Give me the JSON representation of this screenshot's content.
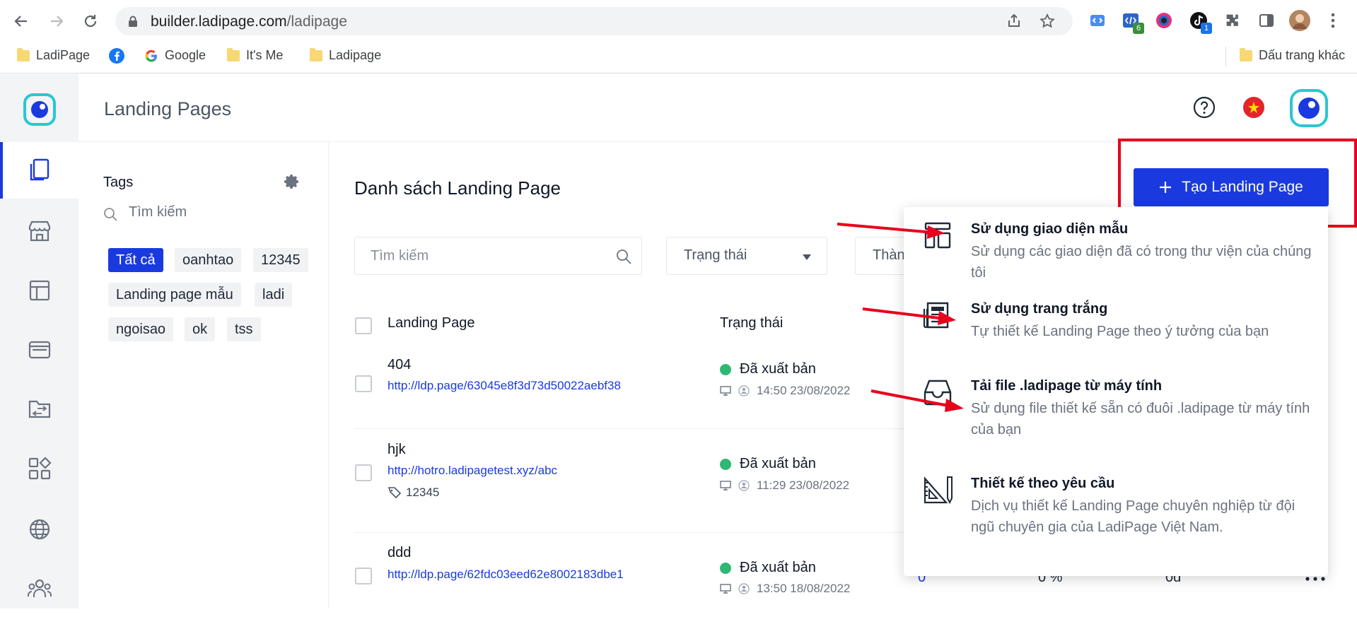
{
  "browser": {
    "url_host": "builder.ladipage.com",
    "url_path": "/ladipage",
    "extensions": {
      "ext2_badge": "6",
      "ext4_badge": "1"
    },
    "bookmarks": [
      "LadiPage",
      "Google",
      "It's Me",
      "Ladipage"
    ],
    "other_bookmarks": "Dấu trang khác"
  },
  "header": {
    "title": "Landing Pages"
  },
  "tags": {
    "title": "Tags",
    "search_placeholder": "Tìm kiếm",
    "chips": [
      "Tất cả",
      "oanhtao",
      "12345",
      "Landing page mẫu",
      "ladi",
      "ngoisao",
      "ok",
      "tss"
    ]
  },
  "main": {
    "title": "Danh sách Landing Page",
    "search_placeholder": "Tìm kiếm",
    "status_filter": "Trạng thái",
    "filter3_partial": "Thàn",
    "col_landing_page": "Landing Page",
    "col_status": "Trạng thái",
    "rows": [
      {
        "name": "404",
        "url": "http://ldp.page/63045e8f3d73d50022aebf38",
        "tag": "",
        "status": "Đã xuất bản",
        "time": "14:50 23/08/2022"
      },
      {
        "name": "hjk",
        "url": "http://hotro.ladipagetest.xyz/abc",
        "tag": "12345",
        "status": "Đã xuất bản",
        "time": "11:29 23/08/2022"
      },
      {
        "name": "ddd",
        "url": "http://ldp.page/62fdc03eed62e8002183dbe1",
        "tag": "",
        "status": "Đã xuất bản",
        "time": "13:50 18/08/2022",
        "visits": "0",
        "rate": "0 %",
        "revenue": "0đ"
      }
    ]
  },
  "cta": {
    "label": "Tạo Landing Page"
  },
  "menu": {
    "items": [
      {
        "title": "Sử dụng giao diện mẫu",
        "desc": "Sử dụng các giao diện đã có trong thư viện của chúng tôi"
      },
      {
        "title": "Sử dụng trang trắng",
        "desc": "Tự thiết kế Landing Page theo ý tưởng của bạn"
      },
      {
        "title": "Tải file .ladipage từ máy tính",
        "desc": "Sử dụng file thiết kế sẵn có đuôi .ladipage từ máy tính của bạn"
      },
      {
        "title": "Thiết kế theo yêu cầu",
        "desc": "Dịch vụ thiết kế Landing Page chuyên nghiệp từ đội ngũ chuyên gia của LadiPage Việt Nam."
      }
    ]
  },
  "colors": {
    "brand_blue": "#1a3ae0",
    "highlight_red": "#e8001c",
    "status_green": "#2eb872"
  }
}
